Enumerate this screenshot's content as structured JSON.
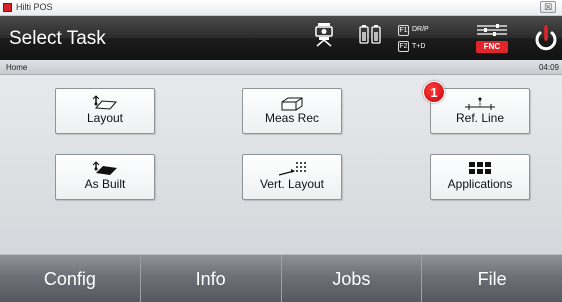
{
  "window": {
    "title": "Hilti POS",
    "close_glyph": "☒"
  },
  "header": {
    "title": "Select Task",
    "icons": [
      "robotic-instrument-icon",
      "battery-icon",
      "settings-slider-icon",
      "power-icon"
    ],
    "fkeys": [
      {
        "key": "F1",
        "label": "DR/P"
      },
      {
        "key": "F2",
        "label": "T+D"
      }
    ],
    "fnc_label": "FNC"
  },
  "breadcrumb": {
    "path": "Home",
    "time": "04:09"
  },
  "tasks": [
    {
      "label": "Layout",
      "icon": "layout-icon"
    },
    {
      "label": "Meas Rec",
      "icon": "measure-record-icon"
    },
    {
      "label": "Ref. Line",
      "icon": "reference-line-icon"
    },
    {
      "label": "As Built",
      "icon": "as-built-icon"
    },
    {
      "label": "Vert. Layout",
      "icon": "vertical-layout-icon"
    },
    {
      "label": "Applications",
      "icon": "applications-grid-icon"
    }
  ],
  "annotation": {
    "number": "1"
  },
  "bottom_nav": [
    "Config",
    "Info",
    "Jobs",
    "File"
  ],
  "colors": {
    "header_bg": "#1c1c1c",
    "badge": "#d40b10",
    "fnc": "#e0262b"
  }
}
